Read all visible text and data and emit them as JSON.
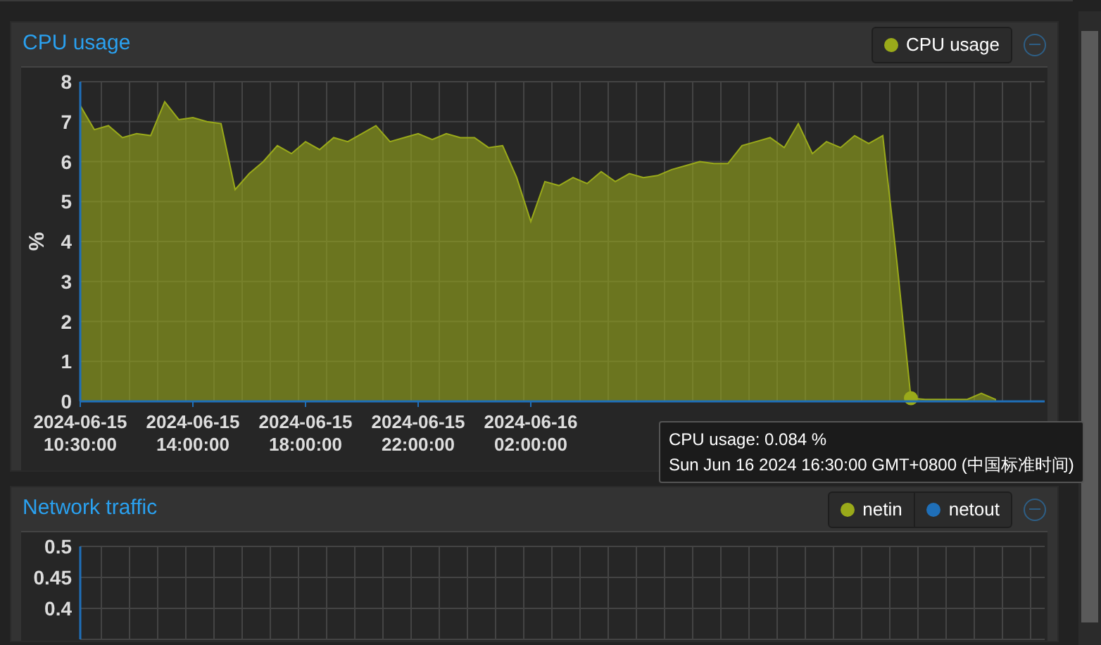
{
  "panels": [
    {
      "title": "CPU usage",
      "chart_data": {
        "type": "area",
        "ylabel": "%",
        "ylim": [
          0,
          8
        ],
        "yticks": [
          0,
          1,
          2,
          3,
          4,
          5,
          6,
          7,
          8
        ],
        "grid": true,
        "categories": [
          "2024-06-15\n10:30:00",
          null,
          null,
          null,
          null,
          null,
          null,
          null,
          "2024-06-15\n14:00:00",
          null,
          null,
          null,
          null,
          null,
          null,
          null,
          "2024-06-15\n18:00:00",
          null,
          null,
          null,
          null,
          null,
          null,
          null,
          "2024-06-15\n22:00:00",
          null,
          null,
          null,
          null,
          null,
          null,
          null,
          "2024-06-16\n02:00:00",
          null,
          null,
          null,
          null,
          null,
          null,
          null,
          null,
          null,
          null,
          null,
          null,
          null,
          null,
          null,
          null,
          null,
          null,
          null,
          null,
          null,
          null,
          null,
          null,
          null,
          null,
          null,
          null,
          null,
          null,
          null,
          null,
          null
        ],
        "series": [
          {
            "name": "CPU usage",
            "color": "#9aaa1a",
            "values": [
              7.4,
              6.8,
              6.9,
              6.6,
              6.7,
              6.65,
              7.5,
              7.05,
              7.1,
              7.0,
              6.95,
              5.3,
              5.7,
              6.0,
              6.4,
              6.2,
              6.5,
              6.3,
              6.6,
              6.5,
              6.7,
              6.9,
              6.5,
              6.6,
              6.7,
              6.55,
              6.7,
              6.6,
              6.6,
              6.35,
              6.4,
              5.6,
              4.5,
              5.5,
              5.4,
              5.6,
              5.45,
              5.75,
              5.5,
              5.7,
              5.6,
              5.65,
              5.8,
              5.9,
              6.0,
              5.95,
              5.95,
              6.4,
              6.5,
              6.6,
              6.35,
              6.95,
              6.2,
              6.5,
              6.35,
              6.65,
              6.45,
              6.65,
              3.5,
              0.08,
              0.05,
              0.05,
              0.05,
              0.05,
              0.2,
              0.05
            ]
          }
        ]
      },
      "tooltip": {
        "lines": [
          "CPU usage: 0.084 %",
          "Sun Jun 16 2024 16:30:00 GMT+0800 (中国标准时间)"
        ]
      }
    },
    {
      "title": "Network traffic",
      "legend": [
        {
          "label": "netin",
          "color": "#9aaa1a"
        },
        {
          "label": "netout",
          "color": "#1f6fb8"
        }
      ],
      "axis": {
        "labels": [
          "0.5",
          "0.45",
          "0.4"
        ]
      }
    }
  ]
}
